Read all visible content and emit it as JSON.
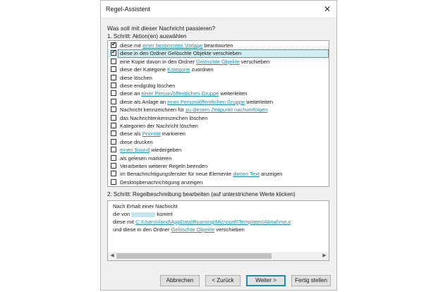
{
  "dialog": {
    "title": "Regel-Assistent"
  },
  "question": "Was soll mit dieser Nachricht passieren?",
  "step1_label": "1. Schritt: Aktion(en) auswählen",
  "actions": [
    {
      "checked": true,
      "parts": [
        {
          "t": "diese mit "
        },
        {
          "t": "einer bestimmten Vorlage",
          "link": true
        },
        {
          "t": " beantworten"
        }
      ]
    },
    {
      "checked": true,
      "selected": true,
      "parts": [
        {
          "t": "diese in den Ordner Gelöschte Objekte verschieben"
        }
      ]
    },
    {
      "checked": false,
      "parts": [
        {
          "t": "eine Kopie davon in den Ordner "
        },
        {
          "t": "Gelöschte Objekte",
          "link": true
        },
        {
          "t": " verschieben"
        }
      ]
    },
    {
      "checked": false,
      "parts": [
        {
          "t": "diese der Kategorie "
        },
        {
          "t": "Kategorie",
          "link": true
        },
        {
          "t": " zuordnen"
        }
      ]
    },
    {
      "checked": false,
      "parts": [
        {
          "t": "diese löschen"
        }
      ]
    },
    {
      "checked": false,
      "parts": [
        {
          "t": "diese endgültig löschen"
        }
      ]
    },
    {
      "checked": false,
      "parts": [
        {
          "t": "diese an "
        },
        {
          "t": "einer Person/öffentlichen Gruppe",
          "link": true
        },
        {
          "t": " weiterleiten"
        }
      ]
    },
    {
      "checked": false,
      "parts": [
        {
          "t": "diese als Anlage an "
        },
        {
          "t": "einer Person/öffentlichen Gruppe",
          "link": true
        },
        {
          "t": " weiterleiten"
        }
      ]
    },
    {
      "checked": false,
      "parts": [
        {
          "t": "Nachricht kennzeichnen für "
        },
        {
          "t": "zu diesem Zeitpunkt nachverfolgen",
          "link": true
        }
      ]
    },
    {
      "checked": false,
      "parts": [
        {
          "t": "das Nachrichtenkennzeichen löschen"
        }
      ]
    },
    {
      "checked": false,
      "parts": [
        {
          "t": "Kategorien der Nachricht löschen"
        }
      ]
    },
    {
      "checked": false,
      "parts": [
        {
          "t": "diese als "
        },
        {
          "t": "Priorität",
          "link": true
        },
        {
          "t": " markieren"
        }
      ]
    },
    {
      "checked": false,
      "parts": [
        {
          "t": "diese drucken"
        }
      ]
    },
    {
      "checked": false,
      "parts": [
        {
          "t": "einen Sound",
          "link": true
        },
        {
          "t": " wiedergeben"
        }
      ]
    },
    {
      "checked": false,
      "parts": [
        {
          "t": "als gelesen markieren"
        }
      ]
    },
    {
      "checked": false,
      "parts": [
        {
          "t": "Verarbeiten weiterer Regeln beenden"
        }
      ]
    },
    {
      "checked": false,
      "parts": [
        {
          "t": "im Benachrichtigungsfenster für neue Elemente "
        },
        {
          "t": "diesen Text",
          "link": true
        },
        {
          "t": " anzeigen"
        }
      ]
    },
    {
      "checked": false,
      "parts": [
        {
          "t": "Desktopbenachrichtigung anzeigen"
        }
      ]
    }
  ],
  "step2_label": "2. Schritt: Regelbeschreibung bearbeiten (auf unterstrichene Werte klicken)",
  "description": {
    "line1": "Nach Erhalt einer Nachricht",
    "line2_pre": "die von",
    "line2_post": " kommt",
    "line3_pre": "diese mit ",
    "line3_link": "C:\\Users\\rland\\AppData\\Roaming\\Microsoft\\Templates\\Abnahme.x",
    "line4_pre": " und diese in den Ordner ",
    "line4_link": "Gelöschte Objekte",
    "line4_post": " verschieben"
  },
  "buttons": {
    "cancel": "Abbrechen",
    "back": "< Zurück",
    "next": "Weiter >",
    "finish": "Fertig stellen"
  },
  "colors": {
    "link": "#1e8fa8",
    "selection": "#cfeff2"
  }
}
